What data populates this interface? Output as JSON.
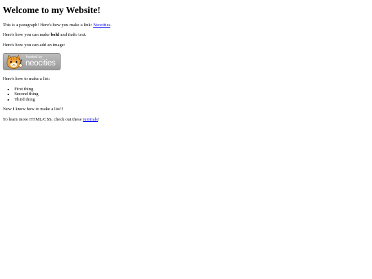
{
  "page": {
    "heading": "Welcome to my Website!",
    "para1": {
      "text": "This is a paragraph! Here's how you make a link: ",
      "link_label": "Neocities",
      "suffix": "."
    },
    "para2": {
      "prefix": "Here's how you can make ",
      "bold": "bold",
      "middle": " and ",
      "italic": "italic",
      "suffix": " text."
    },
    "para3": "Here's how you can add an image:",
    "badge": {
      "icon": "neocities-cat-icon",
      "small_text": "hosted by",
      "brand_text": "neocities",
      "background": "#a9a9a9",
      "cat_color": "#f2a33a"
    },
    "para4": "Here's how to make a list:",
    "list_items": [
      "First thing",
      "Second thing",
      "Third thing"
    ],
    "para5": "Now I know how to make a list!!",
    "para6": {
      "prefix": "To learn more HTML/CSS, check out these ",
      "link_label": "tutorials",
      "suffix": "!"
    },
    "link_color": "#0000ee"
  }
}
